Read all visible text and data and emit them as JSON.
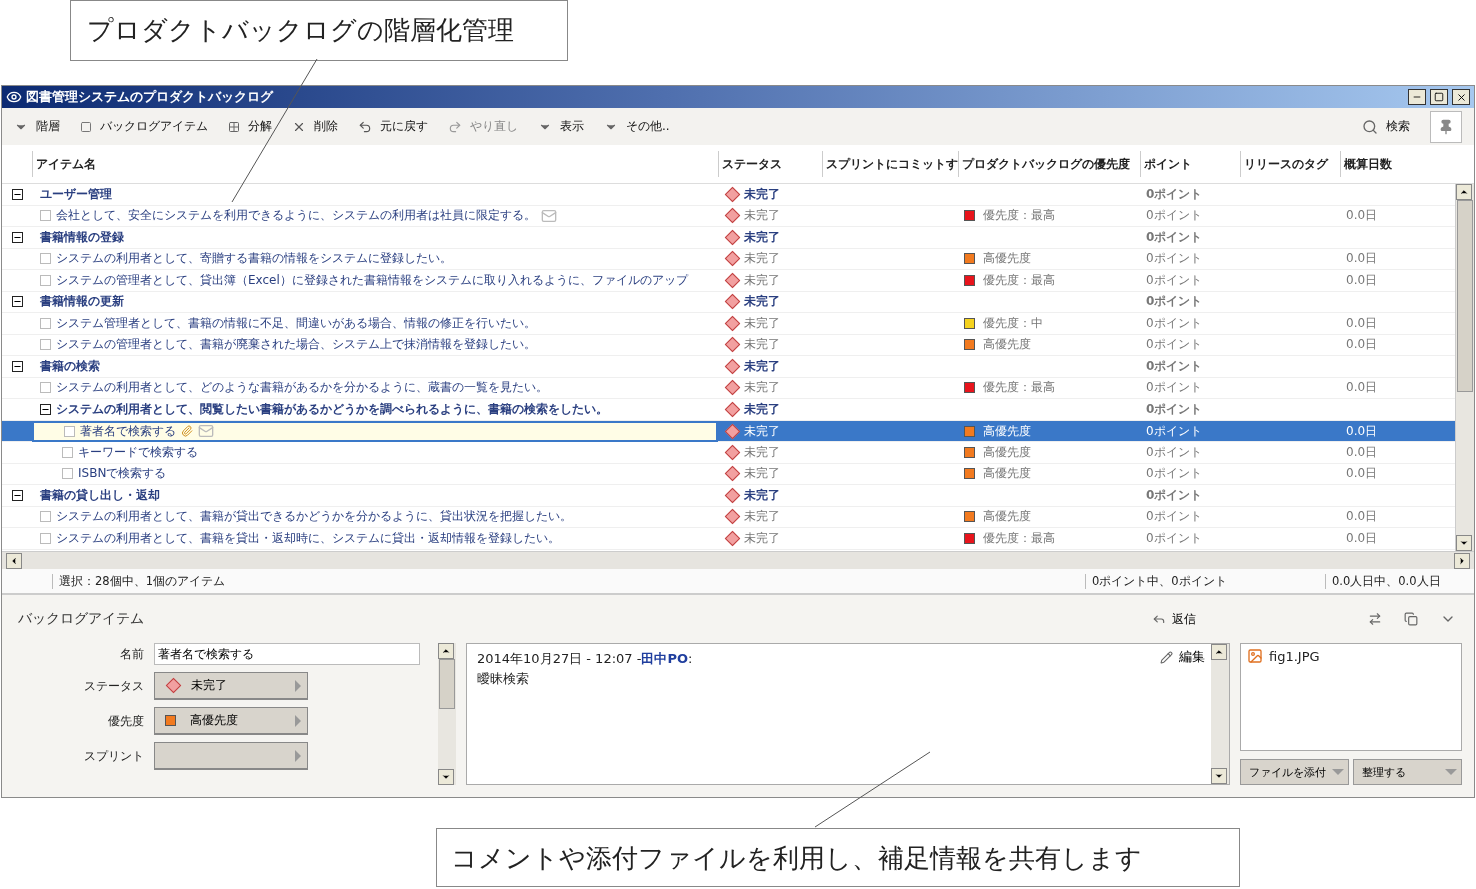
{
  "annotations": [
    {
      "text": "プロダクトバックログの階層化管理"
    },
    {
      "text": "コメントや添付ファイルを利用し、補足情報を共有します"
    }
  ],
  "window": {
    "title": "図書管理システムのプロダクトバックログ"
  },
  "toolbar": {
    "items": [
      {
        "label": "階層",
        "disabled": false
      },
      {
        "label": "バックログアイテム",
        "disabled": false
      },
      {
        "label": "分解",
        "disabled": false
      },
      {
        "label": "削除",
        "disabled": false
      },
      {
        "label": "元に戻す",
        "disabled": false
      },
      {
        "label": "やり直し",
        "disabled": true
      },
      {
        "label": "表示",
        "disabled": false
      },
      {
        "label": "その他..",
        "disabled": false
      }
    ],
    "search": "検索"
  },
  "backlog": {
    "columns": [
      "アイテム名",
      "ステータス",
      "スプリントにコミットす",
      "プロダクトバックログの優先度",
      "ポイント",
      "リリースのタグ",
      "概算日数"
    ],
    "rows": [
      {
        "kind": "group",
        "name": "ユーザー管理",
        "status": "未完了",
        "points": "0ポイント",
        "expanded": true,
        "selected": false,
        "children": [
          {
            "kind": "story",
            "name": "会社として、安全にシステムを利用できるように、システムの利用者は社員に限定する。",
            "status": "未完了",
            "priority": {
              "label": "優先度：最高",
              "color": "#e8141c"
            },
            "points": "0ポイント",
            "days": "0.0日",
            "selected": false,
            "checked": false,
            "comment": true
          }
        ]
      },
      {
        "kind": "group",
        "name": "書籍情報の登録",
        "status": "未完了",
        "points": "0ポイント",
        "expanded": true,
        "selected": false,
        "children": [
          {
            "kind": "story",
            "name": "システムの利用者として、寄贈する書籍の情報をシステムに登録したい。",
            "status": "未完了",
            "priority": {
              "label": "高優先度",
              "color": "#f27a1f"
            },
            "points": "0ポイント",
            "days": "0.0日",
            "selected": false,
            "checked": false
          },
          {
            "kind": "story",
            "name": "システムの管理者として、貸出簿（Excel）に登録された書籍情報をシステムに取り入れるように、ファイルのアップ",
            "status": "未完了",
            "priority": {
              "label": "優先度：最高",
              "color": "#e8141c"
            },
            "points": "0ポイント",
            "days": "0.0日",
            "selected": false,
            "checked": false
          }
        ]
      },
      {
        "kind": "group",
        "name": "書籍情報の更新",
        "status": "未完了",
        "points": "0ポイント",
        "expanded": true,
        "selected": false,
        "children": [
          {
            "kind": "story",
            "name": "システム管理者として、書籍の情報に不足、間違いがある場合、情報の修正を行いたい。",
            "status": "未完了",
            "priority": {
              "label": "優先度：中",
              "color": "#f5d21e"
            },
            "points": "0ポイント",
            "days": "0.0日",
            "selected": false,
            "checked": false
          },
          {
            "kind": "story",
            "name": "システムの管理者として、書籍が廃棄された場合、システム上で抹消情報を登録したい。",
            "status": "未完了",
            "priority": {
              "label": "高優先度",
              "color": "#f27a1f"
            },
            "points": "0ポイント",
            "days": "0.0日",
            "selected": false,
            "checked": false
          }
        ]
      },
      {
        "kind": "group",
        "name": "書籍の検索",
        "status": "未完了",
        "points": "0ポイント",
        "expanded": true,
        "selected": false,
        "children": [
          {
            "kind": "story",
            "name": "システムの利用者として、どのような書籍があるかを分かるように、蔵書の一覧を見たい。",
            "status": "未完了",
            "priority": {
              "label": "優先度：最高",
              "color": "#e8141c"
            },
            "points": "0ポイント",
            "days": "0.0日",
            "selected": false,
            "checked": false
          },
          {
            "kind": "story",
            "name": "システムの利用者として、閲覧したい書籍があるかどうかを調べられるように、書籍の検索をしたい。",
            "status": "未完了",
            "points": "0ポイント",
            "expanded": true,
            "selected": false,
            "children": [
              {
                "kind": "story",
                "name": "著者名で検索する",
                "status": "未完了",
                "priority": {
                  "label": "高優先度",
                  "color": "#f27a1f"
                },
                "points": "0ポイント",
                "days": "0.0日",
                "selected": true,
                "checked": false,
                "attachment": true,
                "comment": true
              },
              {
                "kind": "story",
                "name": "キーワードで検索する",
                "status": "未完了",
                "priority": {
                  "label": "高優先度",
                  "color": "#f27a1f"
                },
                "points": "0ポイント",
                "days": "0.0日",
                "selected": false,
                "checked": false
              },
              {
                "kind": "story",
                "name": "ISBNで検索する",
                "status": "未完了",
                "priority": {
                  "label": "高優先度",
                  "color": "#f27a1f"
                },
                "points": "0ポイント",
                "days": "0.0日",
                "selected": false,
                "checked": false
              }
            ]
          }
        ]
      },
      {
        "kind": "group",
        "name": "書籍の貸し出し・返却",
        "status": "未完了",
        "points": "0ポイント",
        "expanded": true,
        "selected": false,
        "children": [
          {
            "kind": "story",
            "name": "システムの利用者として、書籍が貸出できるかどうかを分かるように、貸出状況を把握したい。",
            "status": "未完了",
            "priority": {
              "label": "高優先度",
              "color": "#f27a1f"
            },
            "points": "0ポイント",
            "days": "0.0日",
            "selected": false,
            "checked": false
          },
          {
            "kind": "story",
            "name": "システムの利用者として、書籍を貸出・返却時に、システムに貸出・返却情報を登録したい。",
            "status": "未完了",
            "priority": {
              "label": "優先度：最高",
              "color": "#e8141c"
            },
            "points": "0ポイント",
            "days": "0.0日",
            "selected": false,
            "checked": false
          }
        ]
      }
    ]
  },
  "status_bar": [
    "選択：28個中、1個のアイテム",
    "0ポイント中、0ポイント",
    "0.0人日中、0.0人日"
  ],
  "detail": {
    "title": "バックログアイテム",
    "reply": "返信",
    "fields": [
      {
        "label": "名前",
        "kind": "text",
        "value": "著者名で検索する"
      },
      {
        "label": "ステータス",
        "kind": "status",
        "value": "未完了"
      },
      {
        "label": "優先度",
        "kind": "priority",
        "value": "高優先度",
        "color": "#f27a1f"
      },
      {
        "label": "スプリント",
        "kind": "select"
      }
    ],
    "comment": {
      "header": "2014年10月27日  - 12:07 -**田中PO**:",
      "body": "曖昧検索",
      "edit": "編集"
    },
    "attachments": [
      {
        "name": "fig1.JPG"
      }
    ],
    "buttons": [
      "ファイルを添付",
      "整理する"
    ]
  }
}
